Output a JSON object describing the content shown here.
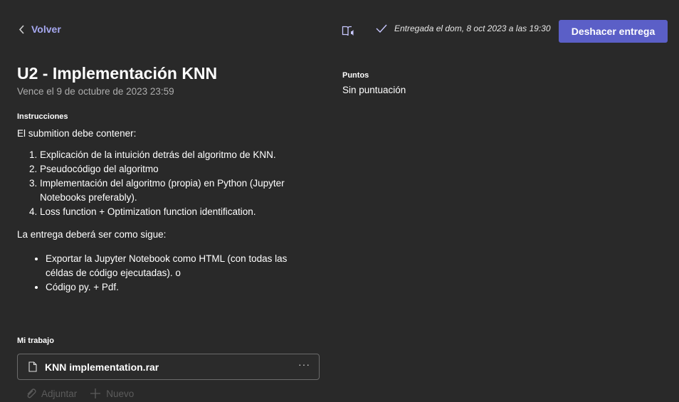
{
  "topbar": {
    "back_label": "Volver",
    "status_text": "Entregada el dom, 8 oct 2023 a las 19:30",
    "undo_button_label": "Deshacer entrega"
  },
  "assignment": {
    "title": "U2 - Implementación KNN",
    "due": "Vence el 9 de octubre de 2023 23:59"
  },
  "instructions": {
    "heading": "Instrucciones",
    "intro": "El submition debe contener:",
    "steps": [
      "Explicación de la intuición detrás del algoritmo de KNN.",
      "Pseudocódigo del algoritmo",
      "Implementación del algoritmo (propia) en Python (Jupyter Notebooks preferably).",
      "Loss function + Optimization function identification."
    ],
    "delivery_intro": "La entrega deberá ser como sigue:",
    "delivery_items": [
      "Exportar la Jupyter Notebook como HTML (con todas las céldas de código ejecutadas). o",
      "Código py. + Pdf."
    ]
  },
  "my_work": {
    "heading": "Mi trabajo",
    "file_name": "KNN implementation.rar",
    "more_label": "···",
    "attach_label": "Adjuntar",
    "new_label": "Nuevo"
  },
  "points": {
    "heading": "Puntos",
    "value": "Sin puntuación"
  },
  "colors": {
    "background": "#292929",
    "accent": "#5b5fc7",
    "link": "#a6a8f0"
  }
}
